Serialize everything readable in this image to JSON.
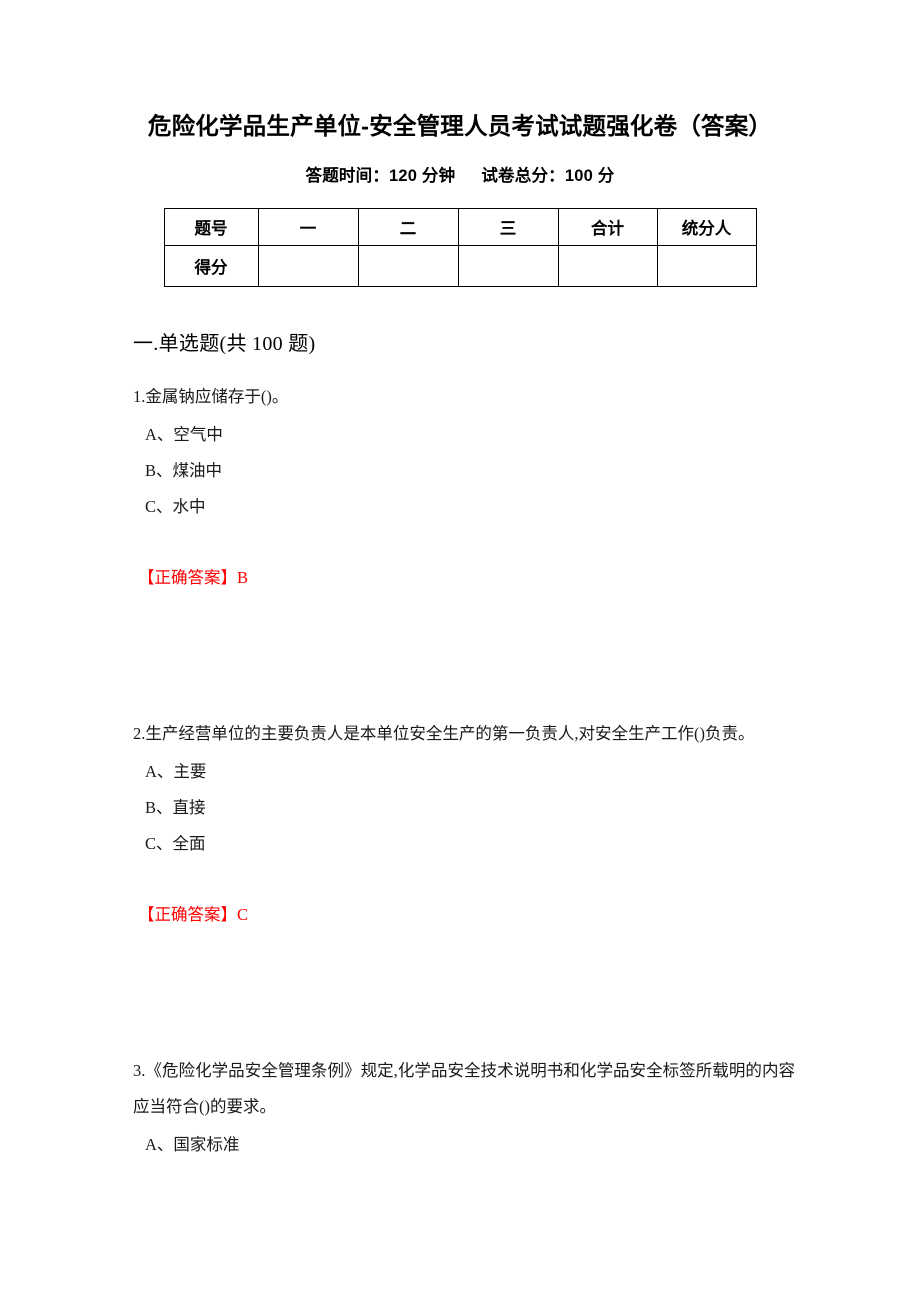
{
  "document": {
    "title": "危险化学品生产单位-安全管理人员考试试题强化卷（答案）",
    "subtitle_time": "答题时间：120 分钟",
    "subtitle_total": "试卷总分：100 分"
  },
  "score_table": {
    "headers": [
      "题号",
      "一",
      "二",
      "三",
      "合计",
      "统分人"
    ],
    "rows": [
      {
        "label": "得分",
        "cells": [
          "",
          "",
          "",
          "",
          ""
        ]
      }
    ]
  },
  "section": {
    "heading": "一.单选题(共 100 题)"
  },
  "questions": [
    {
      "stem": "1.金属钠应储存于()。",
      "options": [
        "A、空气中",
        "B、煤油中",
        "C、水中"
      ],
      "answer_label": "【正确答案】",
      "answer_value": "B"
    },
    {
      "stem": "2.生产经营单位的主要负责人是本单位安全生产的第一负责人,对安全生产工作()负责。",
      "options": [
        "A、主要",
        "B、直接",
        "C、全面"
      ],
      "answer_label": "【正确答案】",
      "answer_value": "C"
    },
    {
      "stem": "3.《危险化学品安全管理条例》规定,化学品安全技术说明书和化学品安全标签所载明的内容应当符合()的要求。",
      "options": [
        "A、国家标准"
      ],
      "answer_label": "",
      "answer_value": ""
    }
  ],
  "colors": {
    "answer_red": "#ff0000",
    "text": "#1a1a1a",
    "table_border": "#000000"
  }
}
